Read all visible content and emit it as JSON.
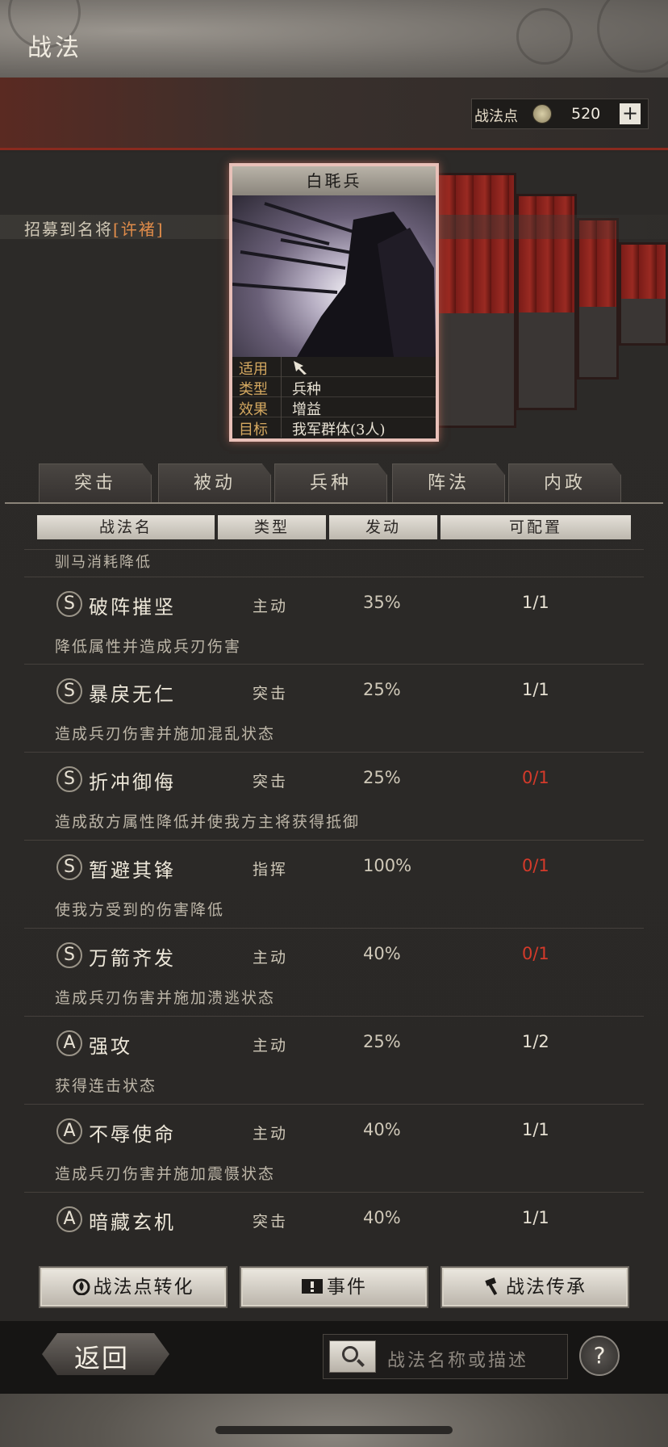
{
  "header": {
    "title": "战法",
    "points_label": "战法点",
    "points_value": "520",
    "plus": "+"
  },
  "recruit": {
    "prefix": "招募到名将",
    "general": "[许褚]"
  },
  "card": {
    "title": "白毦兵",
    "info": [
      {
        "key": "适用",
        "value": ""
      },
      {
        "key": "类型",
        "value": "兵种"
      },
      {
        "key": "效果",
        "value": "增益"
      },
      {
        "key": "目标",
        "value": "我军群体(3人)"
      }
    ]
  },
  "tabs": [
    "突击",
    "被动",
    "兵种",
    "阵法",
    "内政"
  ],
  "columns": {
    "name": "战法名",
    "type": "类型",
    "rate": "发动",
    "config": "可配置"
  },
  "partial_desc": "驯马消耗降低",
  "skills": [
    {
      "grade": "S",
      "name": "破阵摧坚",
      "type": "主动",
      "rate": "35%",
      "count": "1/1",
      "desc": "降低属性并造成兵刃伤害",
      "red": false
    },
    {
      "grade": "S",
      "name": "暴戾无仁",
      "type": "突击",
      "rate": "25%",
      "count": "1/1",
      "desc": "造成兵刃伤害并施加混乱状态",
      "red": false
    },
    {
      "grade": "S",
      "name": "折冲御侮",
      "type": "突击",
      "rate": "25%",
      "count": "0/1",
      "desc": "造成敌方属性降低并使我方主将获得抵御",
      "red": true
    },
    {
      "grade": "S",
      "name": "暂避其锋",
      "type": "指挥",
      "rate": "100%",
      "count": "0/1",
      "desc": "使我方受到的伤害降低",
      "red": true
    },
    {
      "grade": "S",
      "name": "万箭齐发",
      "type": "主动",
      "rate": "40%",
      "count": "0/1",
      "desc": "造成兵刃伤害并施加溃逃状态",
      "red": true
    },
    {
      "grade": "A",
      "name": "强攻",
      "type": "主动",
      "rate": "25%",
      "count": "1/2",
      "desc": "获得连击状态",
      "red": false
    },
    {
      "grade": "A",
      "name": "不辱使命",
      "type": "主动",
      "rate": "40%",
      "count": "1/1",
      "desc": "造成兵刃伤害并施加震慑状态",
      "red": false
    },
    {
      "grade": "A",
      "name": "暗藏玄机",
      "type": "突击",
      "rate": "40%",
      "count": "1/1",
      "desc": "",
      "red": false
    }
  ],
  "buttons": {
    "convert": "战法点转化",
    "events": "事件",
    "inherit": "战法传承"
  },
  "footer": {
    "back": "返回",
    "search_placeholder": "战法名称或描述",
    "help": "?"
  },
  "colors": {
    "accent_red": "#d43a2a",
    "header_red": "#8a2a1e",
    "card_border": "#e8c0b8"
  },
  "icons": [
    "points-coin-icon",
    "plus-icon",
    "flame-icon",
    "exclamation-icon",
    "hammer-icon",
    "search-icon",
    "help-icon"
  ]
}
